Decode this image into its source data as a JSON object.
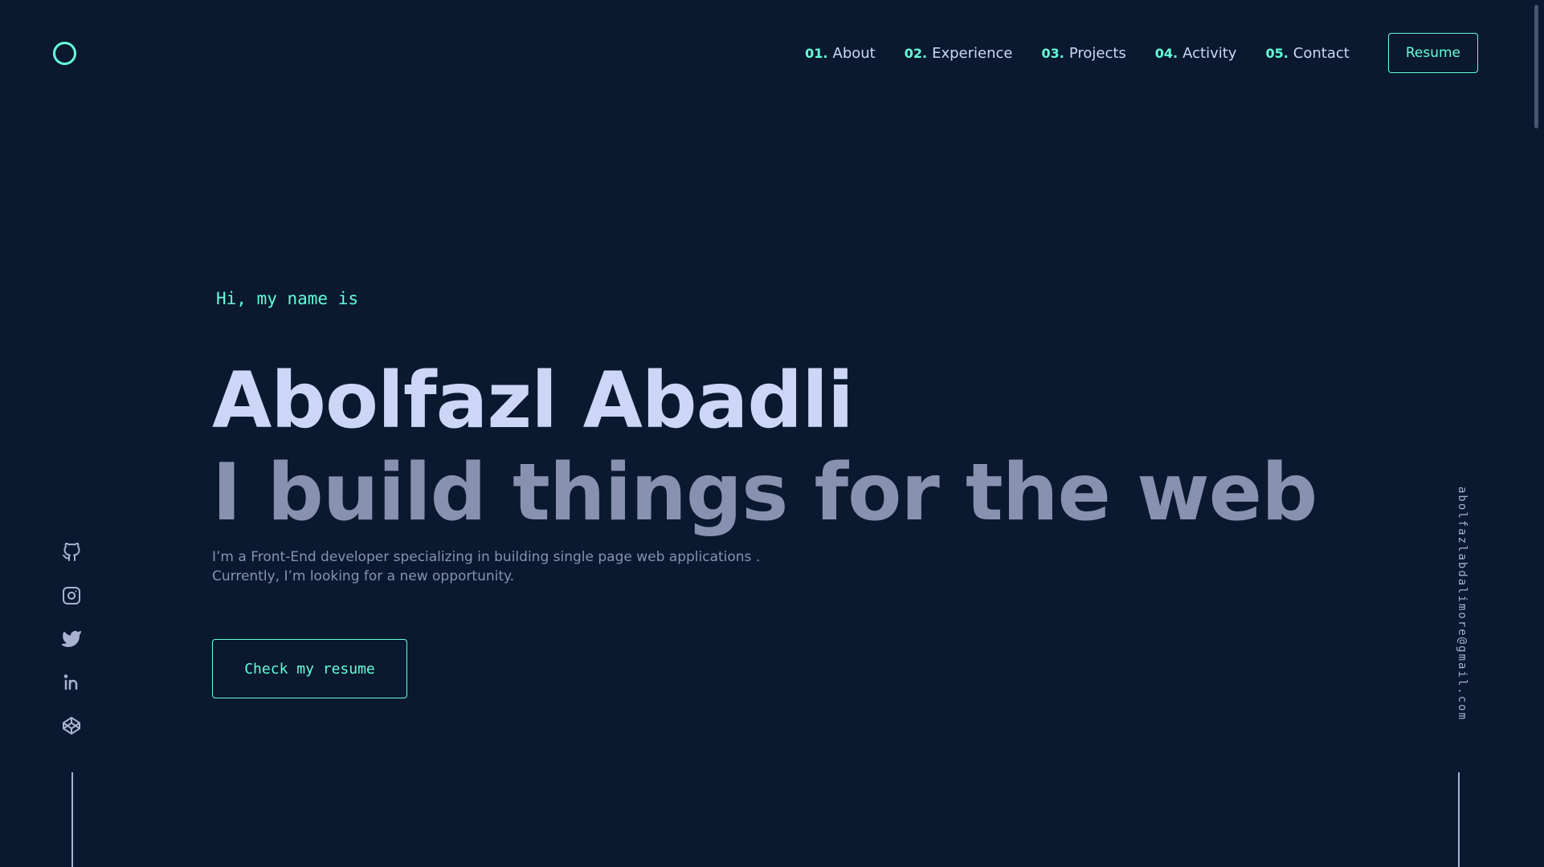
{
  "logo": {
    "icon": "circle-logo-icon"
  },
  "nav": {
    "items": [
      {
        "number": "01.",
        "label": "About"
      },
      {
        "number": "02.",
        "label": "Experience"
      },
      {
        "number": "03.",
        "label": "Projects"
      },
      {
        "number": "04.",
        "label": "Activity"
      },
      {
        "number": "05.",
        "label": "Contact"
      }
    ],
    "resume_label": "Resume"
  },
  "hero": {
    "greeting": "Hi, my name is",
    "name": "Abolfazl Abadli",
    "tagline": "I build things for the web",
    "intro_line1": "I’m a Front-End developer specializing in building single page web applications .",
    "intro_line2": "Currently, I’m looking for a new opportunity.",
    "cta_label": "Check my resume"
  },
  "social": [
    {
      "icon": "github-icon"
    },
    {
      "icon": "instagram-icon"
    },
    {
      "icon": "twitter-icon"
    },
    {
      "icon": "linkedin-icon"
    },
    {
      "icon": "codepen-icon"
    }
  ],
  "email": "abolfazlabdalimore@gmail.com",
  "colors": {
    "background": "#0a192f",
    "accent": "#64ffda",
    "heading": "#ccd6f6",
    "text": "#8892b0"
  }
}
